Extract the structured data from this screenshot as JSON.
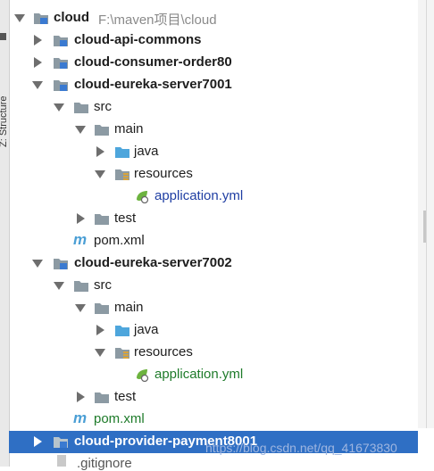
{
  "tree": {
    "root": {
      "name": "cloud",
      "path": "F:\\maven项目\\cloud"
    },
    "modules": [
      {
        "name": "cloud-api-commons"
      },
      {
        "name": "cloud-consumer-order80"
      },
      {
        "name": "cloud-eureka-server7001"
      },
      {
        "name": "cloud-eureka-server7002"
      },
      {
        "name": "cloud-provider-payment8001"
      }
    ],
    "folders": {
      "src": "src",
      "main": "main",
      "java": "java",
      "resources": "resources",
      "test": "test"
    },
    "files": {
      "application": "application.yml",
      "pom": "pom.xml",
      "gitignore": ".gitignore"
    }
  },
  "side_panel": {
    "label": "Z: Structure"
  },
  "watermark": "https://blog.csdn.net/qq_41673830",
  "colors": {
    "selection": "#2f6fc4",
    "module_file_blue": "#1f3ea3",
    "vcs_green": "#1e7b2a",
    "folder": "#8c9aa3"
  }
}
